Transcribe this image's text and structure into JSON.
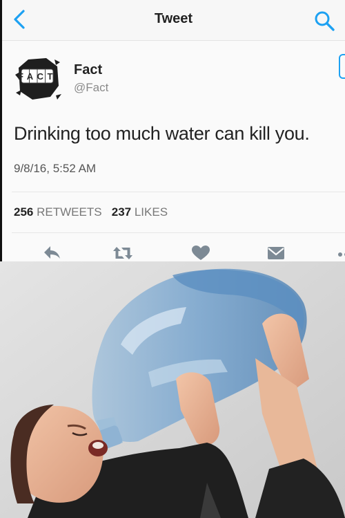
{
  "nav": {
    "title": "Tweet"
  },
  "avatar": {
    "logo_text": "FACT"
  },
  "user": {
    "name": "Fact",
    "handle": "@Fact"
  },
  "tweet": {
    "text": "Drinking too much water can kill you.",
    "timestamp": "9/8/16, 5:52 AM",
    "retweets_count": "256",
    "retweets_label": "RETWEETS",
    "likes_count": "237",
    "likes_label": "LIKES"
  },
  "colors": {
    "accent": "#1da1f2",
    "icon": "#7d8a95",
    "text": "#222222",
    "muted": "#8a8a8a"
  },
  "icons": [
    "back-chevron-icon",
    "search-icon",
    "reply-icon",
    "retweet-icon",
    "like-icon",
    "message-icon",
    "more-icon"
  ]
}
